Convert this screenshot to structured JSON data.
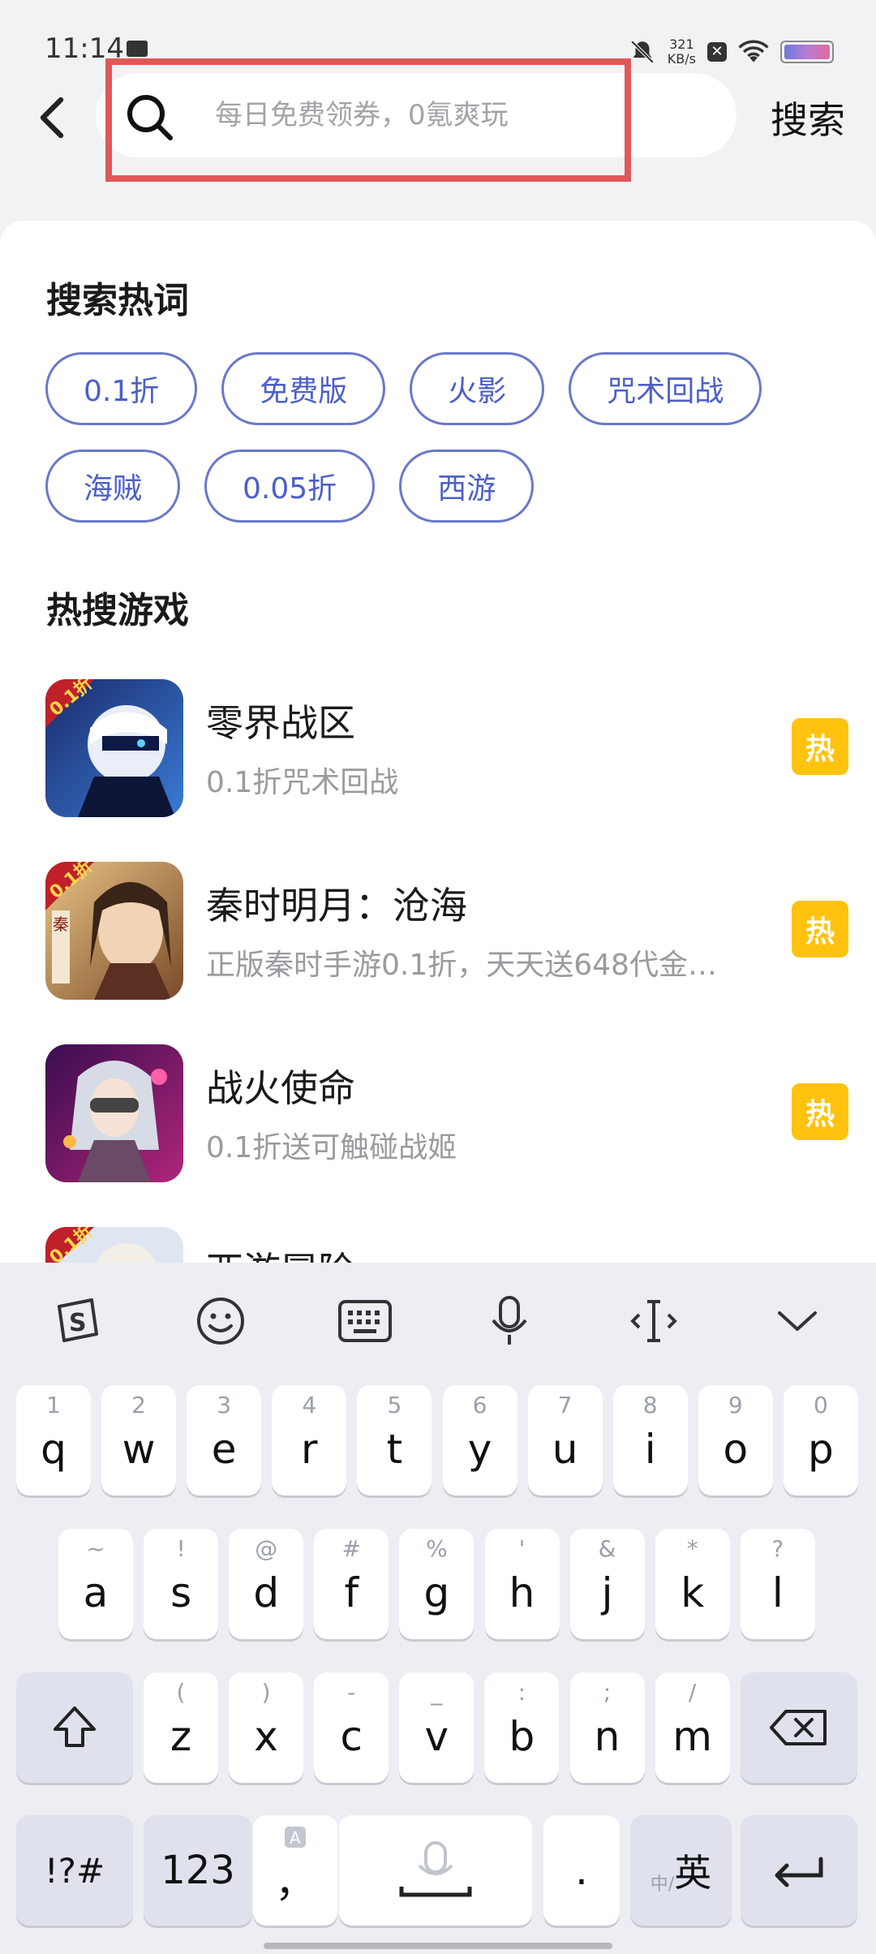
{
  "status_bar": {
    "time": "11:14",
    "net_speed": "321",
    "net_unit": "KB/s"
  },
  "header": {
    "search_placeholder": "每日免费领券，0氪爽玩",
    "search_button": "搜索"
  },
  "hot_words": {
    "title": "搜索热词",
    "rows": [
      [
        "0.1折",
        "免费版",
        "火影",
        "咒术回战"
      ],
      [
        "海贼",
        "0.05折",
        "西游"
      ]
    ]
  },
  "hot_games": {
    "title": "热搜游戏",
    "items": [
      {
        "name": "零界战区",
        "desc": "0.1折咒术回战",
        "badge": "热"
      },
      {
        "name": "秦时明月：沧海",
        "desc": "正版秦时手游0.1折，天天送648代金…",
        "badge": "热"
      },
      {
        "name": "战火使命",
        "desc": "0.1折送可触碰战姬",
        "badge": "热"
      },
      {
        "name": "西游冒险",
        "desc": "",
        "badge": ""
      }
    ]
  },
  "keyboard": {
    "row1": [
      [
        "1",
        "q"
      ],
      [
        "2",
        "w"
      ],
      [
        "3",
        "e"
      ],
      [
        "4",
        "r"
      ],
      [
        "5",
        "t"
      ],
      [
        "6",
        "y"
      ],
      [
        "7",
        "u"
      ],
      [
        "8",
        "i"
      ],
      [
        "9",
        "o"
      ],
      [
        "0",
        "p"
      ]
    ],
    "row2": [
      [
        "~",
        "a"
      ],
      [
        "!",
        "s"
      ],
      [
        "@",
        "d"
      ],
      [
        "#",
        "f"
      ],
      [
        "%",
        "g"
      ],
      [
        "'",
        "h"
      ],
      [
        "&",
        "j"
      ],
      [
        "*",
        "k"
      ],
      [
        "?",
        "l"
      ]
    ],
    "row3": [
      [
        "(",
        "z"
      ],
      [
        ")",
        "x"
      ],
      [
        "-",
        "c"
      ],
      [
        "_",
        "v"
      ],
      [
        ":",
        "b"
      ],
      [
        ";",
        "n"
      ],
      [
        "/",
        "m"
      ]
    ],
    "symbols_key": "!?#",
    "numbers_key": "123",
    "comma_key": "，",
    "period_key": ".",
    "lang_small": "中/",
    "lang_big": "英"
  },
  "colors": {
    "accent_blue": "#4c5fc9",
    "hot_badge": "#ffc30f",
    "highlight_red": "#e05858"
  }
}
